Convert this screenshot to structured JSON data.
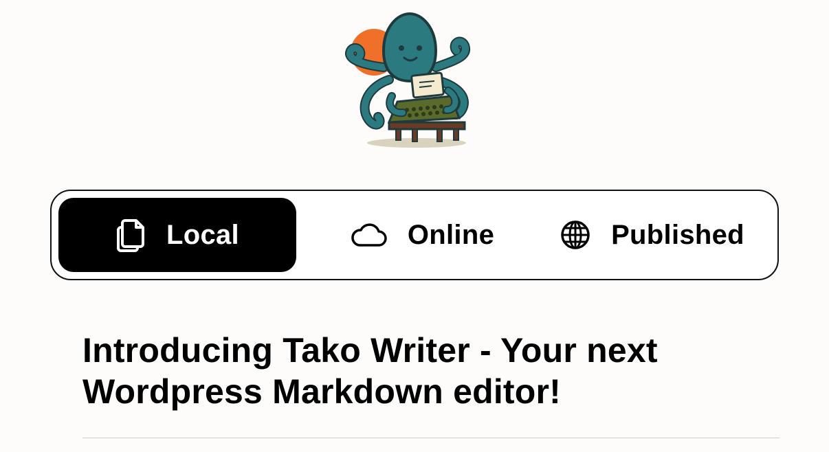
{
  "app": {
    "logo_icon": "octopus-typewriter-logo",
    "colors": {
      "background": "#fdfcfa",
      "active_tab": "#000000",
      "octopus": "#2a7a80",
      "sun": "#f07029",
      "typewriter": "#5a6a2a"
    }
  },
  "tabs": [
    {
      "label": "Local",
      "icon": "documents-icon",
      "active": true
    },
    {
      "label": "Online",
      "icon": "cloud-icon",
      "active": false
    },
    {
      "label": "Published",
      "icon": "globe-icon",
      "active": false
    }
  ],
  "post": {
    "title": "Introducing Tako Writer - Your next Wordpress Markdown editor!"
  }
}
